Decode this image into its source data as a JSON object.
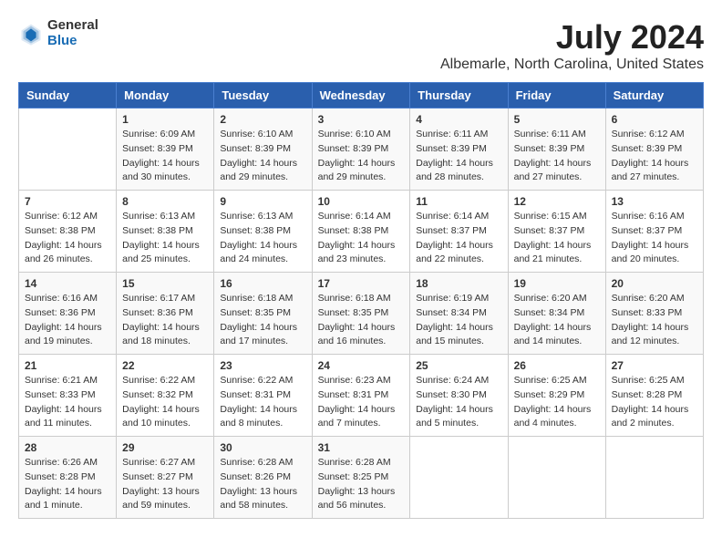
{
  "header": {
    "logo_line1": "General",
    "logo_line2": "Blue",
    "title": "July 2024",
    "subtitle": "Albemarle, North Carolina, United States"
  },
  "calendar": {
    "headers": [
      "Sunday",
      "Monday",
      "Tuesday",
      "Wednesday",
      "Thursday",
      "Friday",
      "Saturday"
    ],
    "weeks": [
      [
        {
          "day": "",
          "info": ""
        },
        {
          "day": "1",
          "info": "Sunrise: 6:09 AM\nSunset: 8:39 PM\nDaylight: 14 hours\nand 30 minutes."
        },
        {
          "day": "2",
          "info": "Sunrise: 6:10 AM\nSunset: 8:39 PM\nDaylight: 14 hours\nand 29 minutes."
        },
        {
          "day": "3",
          "info": "Sunrise: 6:10 AM\nSunset: 8:39 PM\nDaylight: 14 hours\nand 29 minutes."
        },
        {
          "day": "4",
          "info": "Sunrise: 6:11 AM\nSunset: 8:39 PM\nDaylight: 14 hours\nand 28 minutes."
        },
        {
          "day": "5",
          "info": "Sunrise: 6:11 AM\nSunset: 8:39 PM\nDaylight: 14 hours\nand 27 minutes."
        },
        {
          "day": "6",
          "info": "Sunrise: 6:12 AM\nSunset: 8:39 PM\nDaylight: 14 hours\nand 27 minutes."
        }
      ],
      [
        {
          "day": "7",
          "info": "Sunrise: 6:12 AM\nSunset: 8:38 PM\nDaylight: 14 hours\nand 26 minutes."
        },
        {
          "day": "8",
          "info": "Sunrise: 6:13 AM\nSunset: 8:38 PM\nDaylight: 14 hours\nand 25 minutes."
        },
        {
          "day": "9",
          "info": "Sunrise: 6:13 AM\nSunset: 8:38 PM\nDaylight: 14 hours\nand 24 minutes."
        },
        {
          "day": "10",
          "info": "Sunrise: 6:14 AM\nSunset: 8:38 PM\nDaylight: 14 hours\nand 23 minutes."
        },
        {
          "day": "11",
          "info": "Sunrise: 6:14 AM\nSunset: 8:37 PM\nDaylight: 14 hours\nand 22 minutes."
        },
        {
          "day": "12",
          "info": "Sunrise: 6:15 AM\nSunset: 8:37 PM\nDaylight: 14 hours\nand 21 minutes."
        },
        {
          "day": "13",
          "info": "Sunrise: 6:16 AM\nSunset: 8:37 PM\nDaylight: 14 hours\nand 20 minutes."
        }
      ],
      [
        {
          "day": "14",
          "info": "Sunrise: 6:16 AM\nSunset: 8:36 PM\nDaylight: 14 hours\nand 19 minutes."
        },
        {
          "day": "15",
          "info": "Sunrise: 6:17 AM\nSunset: 8:36 PM\nDaylight: 14 hours\nand 18 minutes."
        },
        {
          "day": "16",
          "info": "Sunrise: 6:18 AM\nSunset: 8:35 PM\nDaylight: 14 hours\nand 17 minutes."
        },
        {
          "day": "17",
          "info": "Sunrise: 6:18 AM\nSunset: 8:35 PM\nDaylight: 14 hours\nand 16 minutes."
        },
        {
          "day": "18",
          "info": "Sunrise: 6:19 AM\nSunset: 8:34 PM\nDaylight: 14 hours\nand 15 minutes."
        },
        {
          "day": "19",
          "info": "Sunrise: 6:20 AM\nSunset: 8:34 PM\nDaylight: 14 hours\nand 14 minutes."
        },
        {
          "day": "20",
          "info": "Sunrise: 6:20 AM\nSunset: 8:33 PM\nDaylight: 14 hours\nand 12 minutes."
        }
      ],
      [
        {
          "day": "21",
          "info": "Sunrise: 6:21 AM\nSunset: 8:33 PM\nDaylight: 14 hours\nand 11 minutes."
        },
        {
          "day": "22",
          "info": "Sunrise: 6:22 AM\nSunset: 8:32 PM\nDaylight: 14 hours\nand 10 minutes."
        },
        {
          "day": "23",
          "info": "Sunrise: 6:22 AM\nSunset: 8:31 PM\nDaylight: 14 hours\nand 8 minutes."
        },
        {
          "day": "24",
          "info": "Sunrise: 6:23 AM\nSunset: 8:31 PM\nDaylight: 14 hours\nand 7 minutes."
        },
        {
          "day": "25",
          "info": "Sunrise: 6:24 AM\nSunset: 8:30 PM\nDaylight: 14 hours\nand 5 minutes."
        },
        {
          "day": "26",
          "info": "Sunrise: 6:25 AM\nSunset: 8:29 PM\nDaylight: 14 hours\nand 4 minutes."
        },
        {
          "day": "27",
          "info": "Sunrise: 6:25 AM\nSunset: 8:28 PM\nDaylight: 14 hours\nand 2 minutes."
        }
      ],
      [
        {
          "day": "28",
          "info": "Sunrise: 6:26 AM\nSunset: 8:28 PM\nDaylight: 14 hours\nand 1 minute."
        },
        {
          "day": "29",
          "info": "Sunrise: 6:27 AM\nSunset: 8:27 PM\nDaylight: 13 hours\nand 59 minutes."
        },
        {
          "day": "30",
          "info": "Sunrise: 6:28 AM\nSunset: 8:26 PM\nDaylight: 13 hours\nand 58 minutes."
        },
        {
          "day": "31",
          "info": "Sunrise: 6:28 AM\nSunset: 8:25 PM\nDaylight: 13 hours\nand 56 minutes."
        },
        {
          "day": "",
          "info": ""
        },
        {
          "day": "",
          "info": ""
        },
        {
          "day": "",
          "info": ""
        }
      ]
    ]
  }
}
